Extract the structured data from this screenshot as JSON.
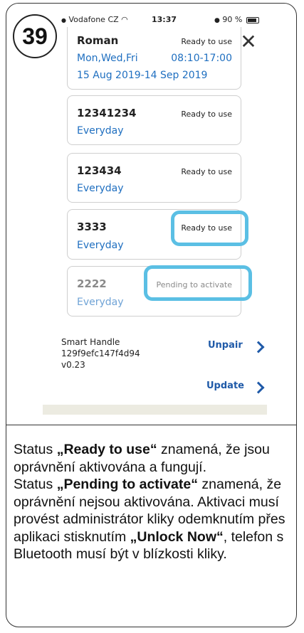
{
  "step_number": "39",
  "status_bar": {
    "carrier": "Vodafone CZ",
    "time": "13:37",
    "battery": "90 %"
  },
  "permissions": [
    {
      "name": "Roman",
      "status": "Ready to use",
      "schedule": "Mon,Wed,Fri",
      "time": "08:10-17:00",
      "date_range": "15 Aug 2019-14 Sep 2019"
    },
    {
      "name": "12341234",
      "status": "Ready to use",
      "schedule": "Everyday"
    },
    {
      "name": "123434",
      "status": "Ready to use",
      "schedule": "Everyday"
    },
    {
      "name": "3333",
      "status": "Ready to use",
      "schedule": "Everyday"
    },
    {
      "name": "2222",
      "status": "Pending to activate",
      "schedule": "Everyday"
    }
  ],
  "device": {
    "name": "Smart Handle",
    "id": "129f9efc147f4d94",
    "version": "v0.23",
    "unpair_label": "Unpair",
    "update_label": "Update"
  },
  "colors": {
    "highlight": "#5bbfe4",
    "link": "#1f6fc0",
    "action": "#1f5aa8"
  },
  "description": {
    "p1_pre": "Status ",
    "p1_bold": "„Ready to use“",
    "p1_post": " znamená, že jsou oprávnění aktivována a fungují.",
    "p2_pre": "Status ",
    "p2_bold": "„Pending to activate“",
    "p2_post": " znamená, že oprávnění nejsou aktivována. Aktivaci musí provést administrátor kliky odemknutím přes aplikaci stisknutím ",
    "p2_bold2": "„Unlock Now“",
    "p2_post2": ", telefon s Bluetooth musí být v blízkosti kliky."
  }
}
